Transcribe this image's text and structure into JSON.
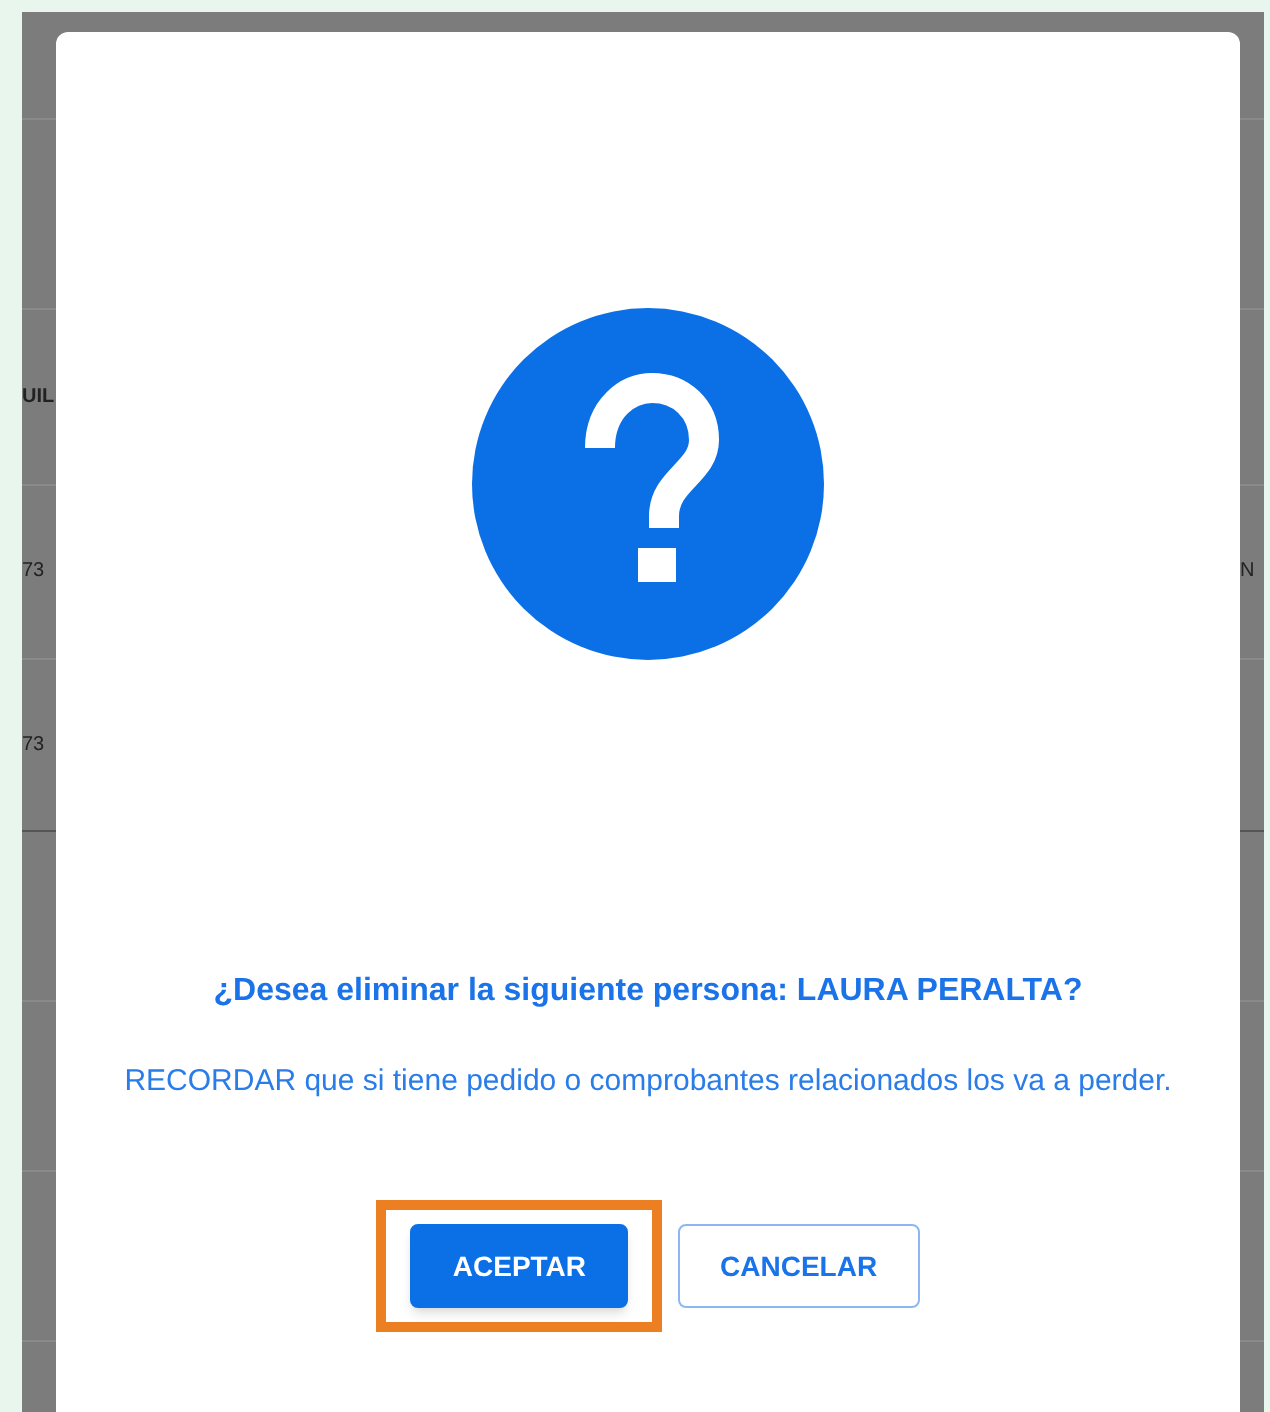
{
  "background_table": {
    "left_cells": [
      {
        "kind": "header",
        "text": "UIL"
      },
      {
        "kind": "cell",
        "text": "73"
      },
      {
        "kind": "cell",
        "text": "73"
      }
    ],
    "right_cells": [
      {
        "text": "N"
      }
    ]
  },
  "dialog": {
    "title": "¿Desea eliminar la siguiente persona: LAURA PERALTA?",
    "message": "RECORDAR que si tiene pedido o comprobantes relacionados los va a perder.",
    "buttons": [
      {
        "label": "ACEPTAR",
        "kind": "primary",
        "highlighted": true
      },
      {
        "label": "CANCELAR",
        "kind": "outline",
        "highlighted": false
      }
    ]
  }
}
